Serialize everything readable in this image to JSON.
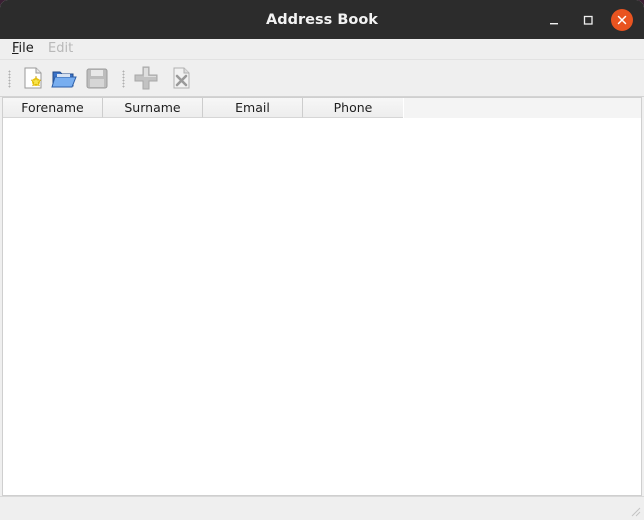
{
  "window": {
    "title": "Address Book",
    "controls": {
      "minimize": "minimize-icon",
      "maximize": "maximize-icon",
      "close": "close-icon"
    },
    "close_color": "#e95420"
  },
  "menubar": {
    "items": [
      {
        "label_mnemonic": "F",
        "label_rest": "ile",
        "enabled": true
      },
      {
        "label": "Edit",
        "enabled": false
      }
    ]
  },
  "toolbar": {
    "buttons": [
      {
        "icon": "new-document-icon",
        "enabled": true
      },
      {
        "icon": "open-folder-icon",
        "enabled": true
      },
      {
        "icon": "save-icon",
        "enabled": false
      },
      {
        "icon": "add-contact-icon",
        "enabled": false
      },
      {
        "icon": "remove-contact-icon",
        "enabled": false
      }
    ]
  },
  "table": {
    "columns": [
      "Forename",
      "Surname",
      "Email",
      "Phone"
    ],
    "rows": []
  },
  "statusbar": {
    "text": ""
  }
}
